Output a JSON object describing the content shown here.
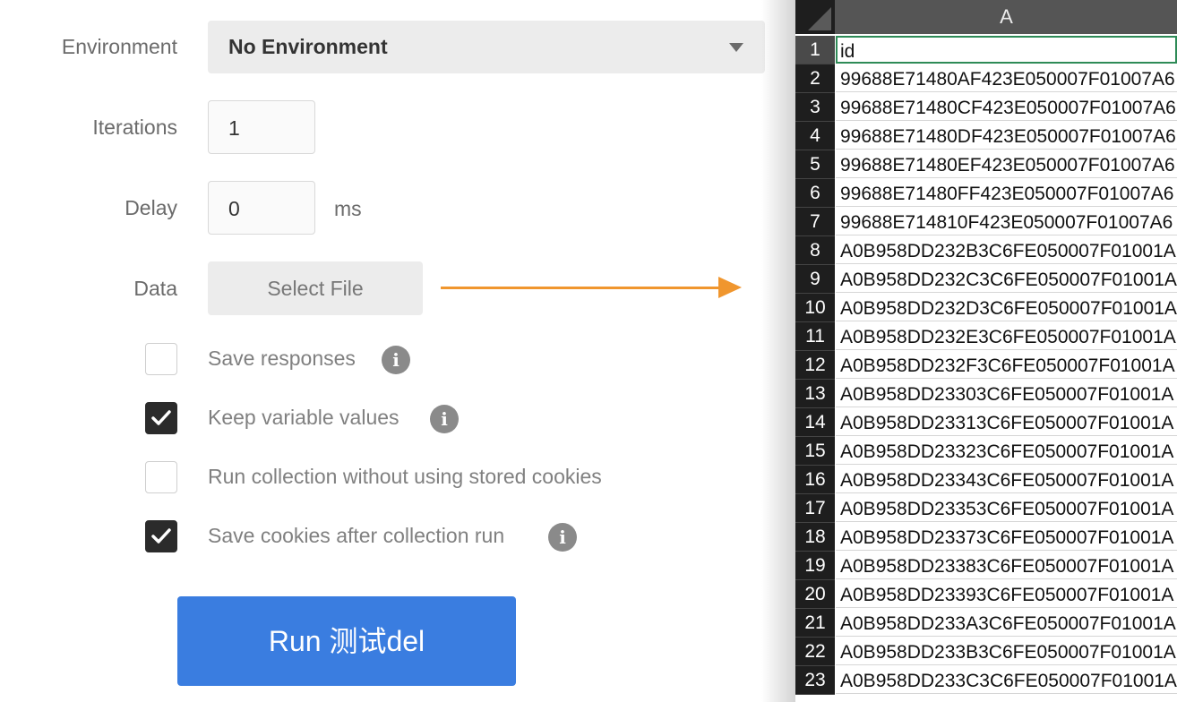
{
  "runner": {
    "environment_label": "Environment",
    "environment_value": "No Environment",
    "iterations_label": "Iterations",
    "iterations_value": "1",
    "delay_label": "Delay",
    "delay_value": "0",
    "delay_unit": "ms",
    "data_label": "Data",
    "select_file_label": "Select File",
    "options": [
      {
        "label": "Save responses",
        "checked": false,
        "has_info": true
      },
      {
        "label": "Keep variable values",
        "checked": true,
        "has_info": true
      },
      {
        "label": "Run collection without using stored cookies",
        "checked": false,
        "has_info": false
      },
      {
        "label": "Save cookies after collection run",
        "checked": true,
        "has_info": true
      }
    ],
    "info_glyph": "i",
    "run_button_label": "Run 测试del",
    "accent_color": "#3a7de0",
    "arrow_color": "#f0962e"
  },
  "spreadsheet": {
    "column_header": "A",
    "rows": [
      {
        "num": "1",
        "value": "id"
      },
      {
        "num": "2",
        "value": "99688E71480AF423E050007F01007A6"
      },
      {
        "num": "3",
        "value": "99688E71480CF423E050007F01007A6"
      },
      {
        "num": "4",
        "value": "99688E71480DF423E050007F01007A6"
      },
      {
        "num": "5",
        "value": "99688E71480EF423E050007F01007A6"
      },
      {
        "num": "6",
        "value": "99688E71480FF423E050007F01007A6"
      },
      {
        "num": "7",
        "value": "99688E714810F423E050007F01007A6"
      },
      {
        "num": "8",
        "value": "A0B958DD232B3C6FE050007F01001A"
      },
      {
        "num": "9",
        "value": "A0B958DD232C3C6FE050007F01001A"
      },
      {
        "num": "10",
        "value": "A0B958DD232D3C6FE050007F01001A"
      },
      {
        "num": "11",
        "value": "A0B958DD232E3C6FE050007F01001A"
      },
      {
        "num": "12",
        "value": "A0B958DD232F3C6FE050007F01001A"
      },
      {
        "num": "13",
        "value": "A0B958DD23303C6FE050007F01001A"
      },
      {
        "num": "14",
        "value": "A0B958DD23313C6FE050007F01001A"
      },
      {
        "num": "15",
        "value": "A0B958DD23323C6FE050007F01001A"
      },
      {
        "num": "16",
        "value": "A0B958DD23343C6FE050007F01001A"
      },
      {
        "num": "17",
        "value": "A0B958DD23353C6FE050007F01001A"
      },
      {
        "num": "18",
        "value": "A0B958DD23373C6FE050007F01001A"
      },
      {
        "num": "19",
        "value": "A0B958DD23383C6FE050007F01001A"
      },
      {
        "num": "20",
        "value": "A0B958DD23393C6FE050007F01001A"
      },
      {
        "num": "21",
        "value": "A0B958DD233A3C6FE050007F01001A"
      },
      {
        "num": "22",
        "value": "A0B958DD233B3C6FE050007F01001A"
      },
      {
        "num": "23",
        "value": "A0B958DD233C3C6FE050007F01001A"
      }
    ]
  }
}
